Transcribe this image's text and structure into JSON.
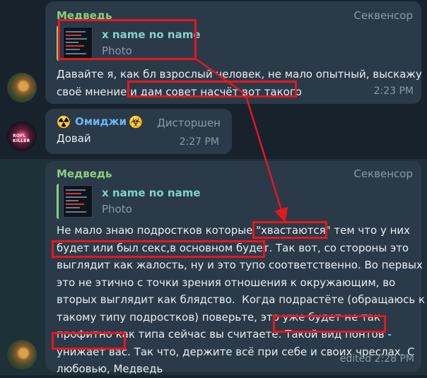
{
  "messages": [
    {
      "author": "Медведь",
      "badge": "Секвенсор",
      "reply": {
        "title": "x name no name",
        "subtitle": "Photo"
      },
      "lines": [
        "Давайте я, как бл взрослый человек, не мало опытный, выскажу",
        "своё мнение и дам совет насчёт вот такого"
      ],
      "time": "2:23 PM"
    },
    {
      "author": "Омиджи",
      "badge": "Дисторшен",
      "lead_emoji": "☢️",
      "tail_emoji": "☣️",
      "lines": [
        "Довай"
      ],
      "time": "2:27 PM"
    },
    {
      "author": "Медведь",
      "badge": "Секвенсор",
      "reply": {
        "title": "x name no name",
        "subtitle": "Photo"
      },
      "lines": [
        "Не мало знаю подростков которые \"хвастаются\" тем что у них",
        "будет или был секс,в основном будет. Так вот, со стороны это",
        "выглядит как жалость, ну и это тупо соответственно. Во первых",
        "это не этично с точки зрения отношения к окружающим, во",
        "вторых выглядит как блядство.  Когда подрастёте (обращаюсь к",
        "такому типу подростков) поверьте, это уже будет не так",
        "профитно как типа сейчас вы считаете. Такой вид понтов -",
        "унижает вас. Так что, держите всё при себе и своих чреслах. С",
        "любовью, Медведь"
      ],
      "time": "edited 2:28 PM"
    }
  ],
  "avatar_label": "ROFL KILLER",
  "colors": {
    "accent_name": "#8bd07d",
    "name_blue": "#68b6f0",
    "annotation": "#e8161d"
  }
}
